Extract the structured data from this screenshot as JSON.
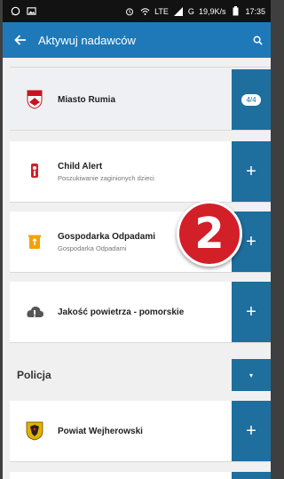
{
  "status_bar": {
    "network": "LTE",
    "signal": "G",
    "speed": "19,9K/s",
    "time": "17:35"
  },
  "app_bar": {
    "title": "Aktywuj nadawców"
  },
  "items": [
    {
      "name": "Miasto Rumia",
      "subtitle": "",
      "action": "4/4",
      "logo_icon": "rumia-coat-of-arms-icon"
    },
    {
      "name": "Child Alert",
      "subtitle": "Poszukiwanie zaginionych dzieci",
      "action": "+",
      "logo_icon": "child-alert-icon"
    },
    {
      "name": "Gospodarka Odpadami",
      "subtitle": "Gospodarka Odpadami",
      "action": "+",
      "logo_icon": "waste-bin-icon"
    },
    {
      "name": "Jakość powietrza - pomorskie",
      "subtitle": "",
      "action": "+",
      "logo_icon": "cloud-icon"
    }
  ],
  "section": {
    "label": "Policja",
    "toggle": "▾"
  },
  "items_policja": [
    {
      "name": "Powiat Wejherowski",
      "subtitle": "",
      "action": "+",
      "logo_icon": "wejherowo-coat-of-arms-icon"
    }
  ],
  "overlay_badge": "2",
  "colors": {
    "app_bar": "#1f79b8",
    "action_button": "#1e6e9e",
    "badge": "#d21f28"
  }
}
